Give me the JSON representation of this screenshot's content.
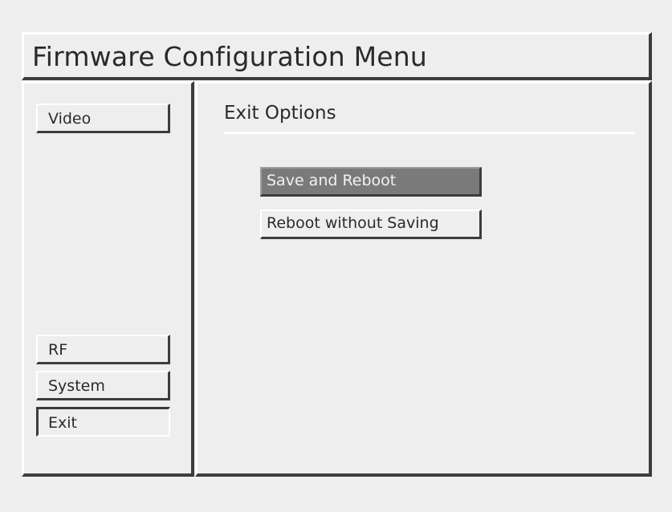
{
  "header": {
    "title": "Firmware Configuration Menu"
  },
  "sidebar": {
    "items": [
      {
        "label": "Video",
        "active": false
      },
      {
        "label": "RF",
        "active": false
      },
      {
        "label": "System",
        "active": false
      },
      {
        "label": "Exit",
        "active": true
      }
    ]
  },
  "main": {
    "section_title": "Exit Options",
    "actions": [
      {
        "label": "Save and Reboot",
        "selected": true
      },
      {
        "label": "Reboot without Saving",
        "selected": false
      }
    ]
  },
  "colors": {
    "background": "#eeeeee",
    "bevel_dark": "#3c3c3c",
    "bevel_light": "#ffffff",
    "selected_fill": "#7a7a7a",
    "text": "#2a2a2a"
  }
}
